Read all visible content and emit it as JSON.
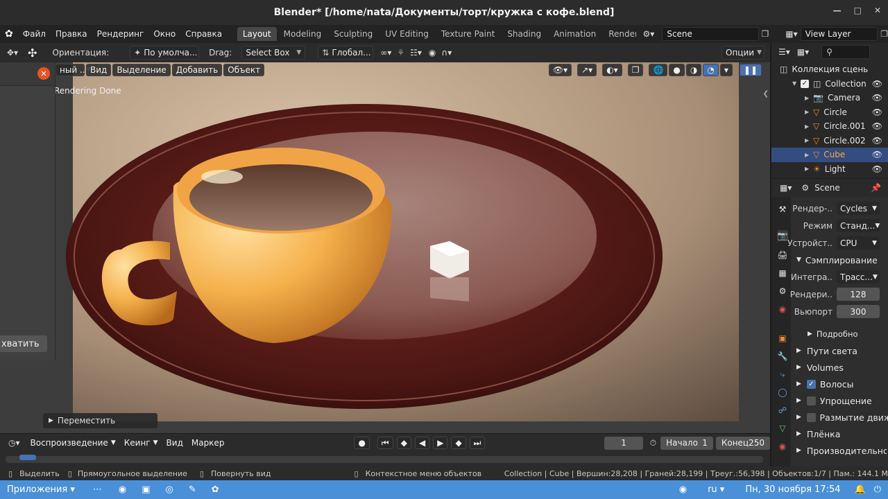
{
  "window": {
    "title": "Blender* [/home/nata/Документы/торт/кружка с кофе.blend]"
  },
  "topbar": {
    "menus": [
      "Файл",
      "Правка",
      "Рендеринг",
      "Окно",
      "Справка"
    ],
    "workspaces": [
      "Layout",
      "Modeling",
      "Sculpting",
      "UV Editing",
      "Texture Paint",
      "Shading",
      "Animation",
      "Renderir"
    ],
    "active_workspace": "Layout",
    "scene": "Scene",
    "view_layer": "View Layer"
  },
  "toolheader": {
    "orientation_label": "Ориентация:",
    "orientation_value": "По умолча...",
    "drag_label": "Drag:",
    "drag_value": "Select Box",
    "transform_value": "Глобал...",
    "options": "Опции"
  },
  "viewport": {
    "mode_value": "ный ..",
    "menus": [
      "Вид",
      "Выделение",
      "Добавить",
      "Объект"
    ],
    "render_status": "Rendering Done",
    "left_panel_button": "хватить",
    "operator_panel": "Переместить"
  },
  "outliner": {
    "root": "Коллекция сцень",
    "items": [
      {
        "name": "Collection",
        "icon": "collection-icon",
        "selected": false
      },
      {
        "name": "Camera",
        "icon": "camera-icon",
        "selected": false
      },
      {
        "name": "Circle",
        "icon": "mesh-icon",
        "selected": false
      },
      {
        "name": "Circle.001",
        "icon": "mesh-icon",
        "selected": false
      },
      {
        "name": "Circle.002",
        "icon": "mesh-icon",
        "selected": false
      },
      {
        "name": "Cube",
        "icon": "mesh-icon",
        "selected": true
      },
      {
        "name": "Light",
        "icon": "light-icon",
        "selected": false
      }
    ]
  },
  "properties": {
    "context": "Scene",
    "render_engine_label": "Рендер-..",
    "render_engine": "Cycles",
    "mode_label": "Режим",
    "mode": "Станд...",
    "device_label": "Устройст..",
    "device": "CPU",
    "sampling": "Сэмплирование",
    "integrator_label": "Интегра..",
    "integrator": "Трасс...",
    "render_samples_label": "Рендери..",
    "render_samples": "128",
    "viewport_samples_label": "Вьюпорт",
    "viewport_samples": "300",
    "advanced": "Подробно",
    "sections": [
      {
        "label": "Пути света",
        "checkbox": null
      },
      {
        "label": "Volumes",
        "checkbox": null
      },
      {
        "label": "Волосы",
        "checkbox": true
      },
      {
        "label": "Упрощение",
        "checkbox": false
      },
      {
        "label": "Размытие движ",
        "checkbox": false
      },
      {
        "label": "Плёнка",
        "checkbox": null
      },
      {
        "label": "Производительнос",
        "checkbox": null
      }
    ]
  },
  "timeline": {
    "menus": [
      "Воспроизведение",
      "Кеинг",
      "Вид",
      "Маркер"
    ],
    "current_frame": "1",
    "start_label": "Начало",
    "start": "1",
    "end_label": "Конец",
    "end": "250"
  },
  "statusbar": {
    "select": "Выделить",
    "box_select": "Прямоугольное выделение",
    "rotate_view": "Повернуть вид",
    "context_menu": "Контекстное меню объектов",
    "stats": "Collection | Cube | Вершин:28,208 | Граней:28,199 | Треуг.:56,398 | Объектов:1/7 | Пам.: 144.1 M"
  },
  "taskbar": {
    "apps": "Приложения",
    "lang": "ru",
    "datetime": "Пн, 30 ноября 17:54"
  }
}
